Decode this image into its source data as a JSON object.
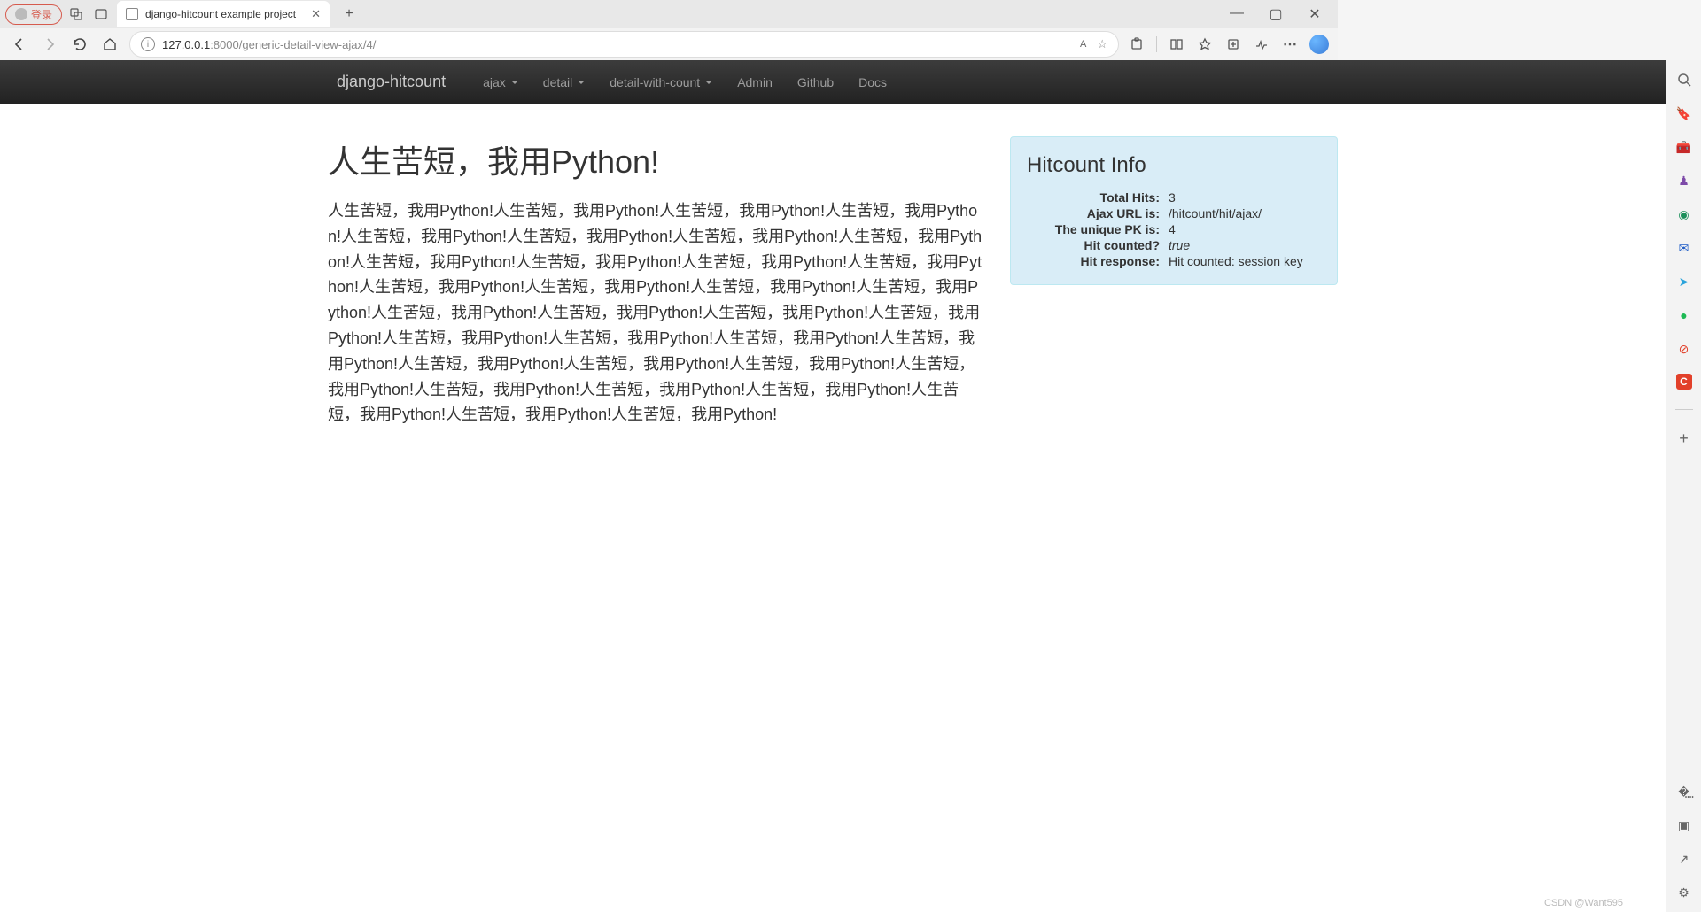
{
  "browser": {
    "login_label": "登录",
    "tab_title": "django-hitcount example project",
    "url_host": "127.0.0.1",
    "url_port": ":8000",
    "url_path": "/generic-detail-view-ajax/4/",
    "font_indicator": "A",
    "window_min": "—",
    "window_max": "▢",
    "window_close": "✕"
  },
  "navbar": {
    "brand": "django-hitcount",
    "items": [
      {
        "label": "ajax",
        "dropdown": true
      },
      {
        "label": "detail",
        "dropdown": true
      },
      {
        "label": "detail-with-count",
        "dropdown": true
      },
      {
        "label": "Admin",
        "dropdown": false
      },
      {
        "label": "Github",
        "dropdown": false
      },
      {
        "label": "Docs",
        "dropdown": false
      }
    ]
  },
  "page": {
    "title": "人生苦短，我用Python!",
    "body": "人生苦短，我用Python!人生苦短，我用Python!人生苦短，我用Python!人生苦短，我用Python!人生苦短，我用Python!人生苦短，我用Python!人生苦短，我用Python!人生苦短，我用Python!人生苦短，我用Python!人生苦短，我用Python!人生苦短，我用Python!人生苦短，我用Python!人生苦短，我用Python!人生苦短，我用Python!人生苦短，我用Python!人生苦短，我用Python!人生苦短，我用Python!人生苦短，我用Python!人生苦短，我用Python!人生苦短，我用Python!人生苦短，我用Python!人生苦短，我用Python!人生苦短，我用Python!人生苦短，我用Python!人生苦短，我用Python!人生苦短，我用Python!人生苦短，我用Python!人生苦短，我用Python!人生苦短，我用Python!人生苦短，我用Python!人生苦短，我用Python!人生苦短，我用Python!人生苦短，我用Python!人生苦短，我用Python!"
  },
  "hitcount": {
    "panel_title": "Hitcount Info",
    "rows": [
      {
        "label": "Total Hits:",
        "value": "3"
      },
      {
        "label": "Ajax URL is:",
        "value": "/hitcount/hit/ajax/"
      },
      {
        "label": "The unique PK is:",
        "value": "4"
      },
      {
        "label": "Hit counted?",
        "value": "true",
        "italic": true
      },
      {
        "label": "Hit response:",
        "value": "Hit counted: session key"
      }
    ]
  },
  "watermark": "CSDN @Want595"
}
